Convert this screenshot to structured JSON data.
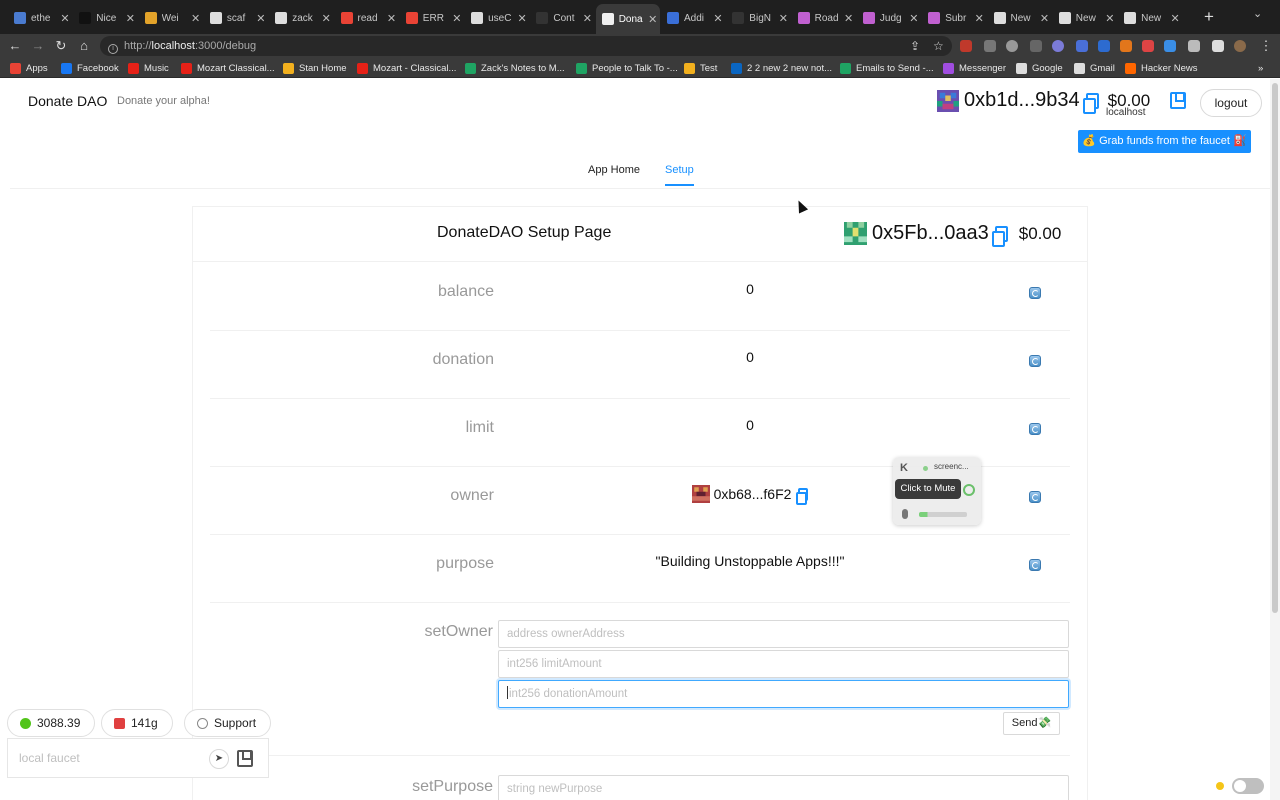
{
  "browser": {
    "tabs": [
      {
        "label": "ethe",
        "color": "#4a7bd0"
      },
      {
        "label": "Nice",
        "color": "#111111"
      },
      {
        "label": "Wei",
        "color": "#e3a32a"
      },
      {
        "label": "scaf",
        "color": "#dddddd"
      },
      {
        "label": "zack",
        "color": "#dddddd"
      },
      {
        "label": "read",
        "color": "#e94335"
      },
      {
        "label": "ERR",
        "color": "#e94335"
      },
      {
        "label": "useC",
        "color": "#dddddd"
      },
      {
        "label": "Cont",
        "color": "#333333"
      },
      {
        "label": "Dona",
        "color": "#f0f0f0"
      },
      {
        "label": "Addi",
        "color": "#3a6fd8"
      },
      {
        "label": "BigN",
        "color": "#333333"
      },
      {
        "label": "Road",
        "color": "#c060d0"
      },
      {
        "label": "Judg",
        "color": "#c060d0"
      },
      {
        "label": "Subr",
        "color": "#c060d0"
      },
      {
        "label": "New",
        "color": "#dddddd"
      },
      {
        "label": "New",
        "color": "#dddddd"
      },
      {
        "label": "New",
        "color": "#dddddd"
      }
    ],
    "url_prefix": "http://",
    "url_host": "localhost",
    "url_path": ":3000/debug",
    "bookmarks": [
      {
        "label": "Apps",
        "color": "#e94335"
      },
      {
        "label": "Facebook",
        "color": "#1877f2"
      },
      {
        "label": "Music",
        "color": "#e62117"
      },
      {
        "label": "Mozart Classical...",
        "color": "#e62117"
      },
      {
        "label": "Stan Home",
        "color": "#f2b01e"
      },
      {
        "label": "Mozart - Classical...",
        "color": "#e62117"
      },
      {
        "label": "Zack's Notes to M...",
        "color": "#1fa463"
      },
      {
        "label": "People to Talk To -...",
        "color": "#1fa463"
      },
      {
        "label": "Test",
        "color": "#f2b01e"
      },
      {
        "label": "2 2 new 2 new not...",
        "color": "#0a66c2"
      },
      {
        "label": "Emails to Send -...",
        "color": "#1fa463"
      },
      {
        "label": "Messenger",
        "color": "#a04de0"
      },
      {
        "label": "Google",
        "color": "#dddddd"
      },
      {
        "label": "Gmail",
        "color": "#dddddd"
      },
      {
        "label": "Hacker News",
        "color": "#ff6600"
      }
    ]
  },
  "header": {
    "brand": "Donate DAO",
    "tagline": "Donate your alpha!",
    "account_address": "0xb1d...9b34",
    "account_balance": "$0.00",
    "network": "localhost",
    "logout_label": "logout",
    "faucet_label": "💰 Grab funds from the faucet ⛽"
  },
  "menu": {
    "home_label": "App Home",
    "setup_label": "Setup"
  },
  "card": {
    "title": "DonateDAO Setup Page",
    "contract_address": "0x5Fb...0aa3",
    "contract_balance": "$0.00"
  },
  "rows": {
    "balance": {
      "label": "balance",
      "value": "0"
    },
    "donation": {
      "label": "donation",
      "value": "0"
    },
    "limit": {
      "label": "limit",
      "value": "0"
    },
    "owner": {
      "label": "owner",
      "value": "0xb68...f6F2"
    },
    "purpose": {
      "label": "purpose",
      "value": "\"Building Unstoppable Apps!!!\""
    }
  },
  "functions": {
    "set_owner": {
      "label": "setOwner",
      "inputs": [
        "address ownerAddress",
        "int256 limitAmount",
        "int256 donationAmount"
      ],
      "send_label": "Send💸"
    },
    "set_purpose": {
      "label": "setPurpose",
      "input": "string newPurpose"
    }
  },
  "overlay": {
    "app_label": "screenc...",
    "tooltip": "Click to Mute"
  },
  "footer": {
    "eth_price": "3088.39",
    "gas_price": "141g",
    "support_label": "Support",
    "faucet_placeholder": "local faucet"
  },
  "colors": {
    "accent": "#1890ff"
  }
}
